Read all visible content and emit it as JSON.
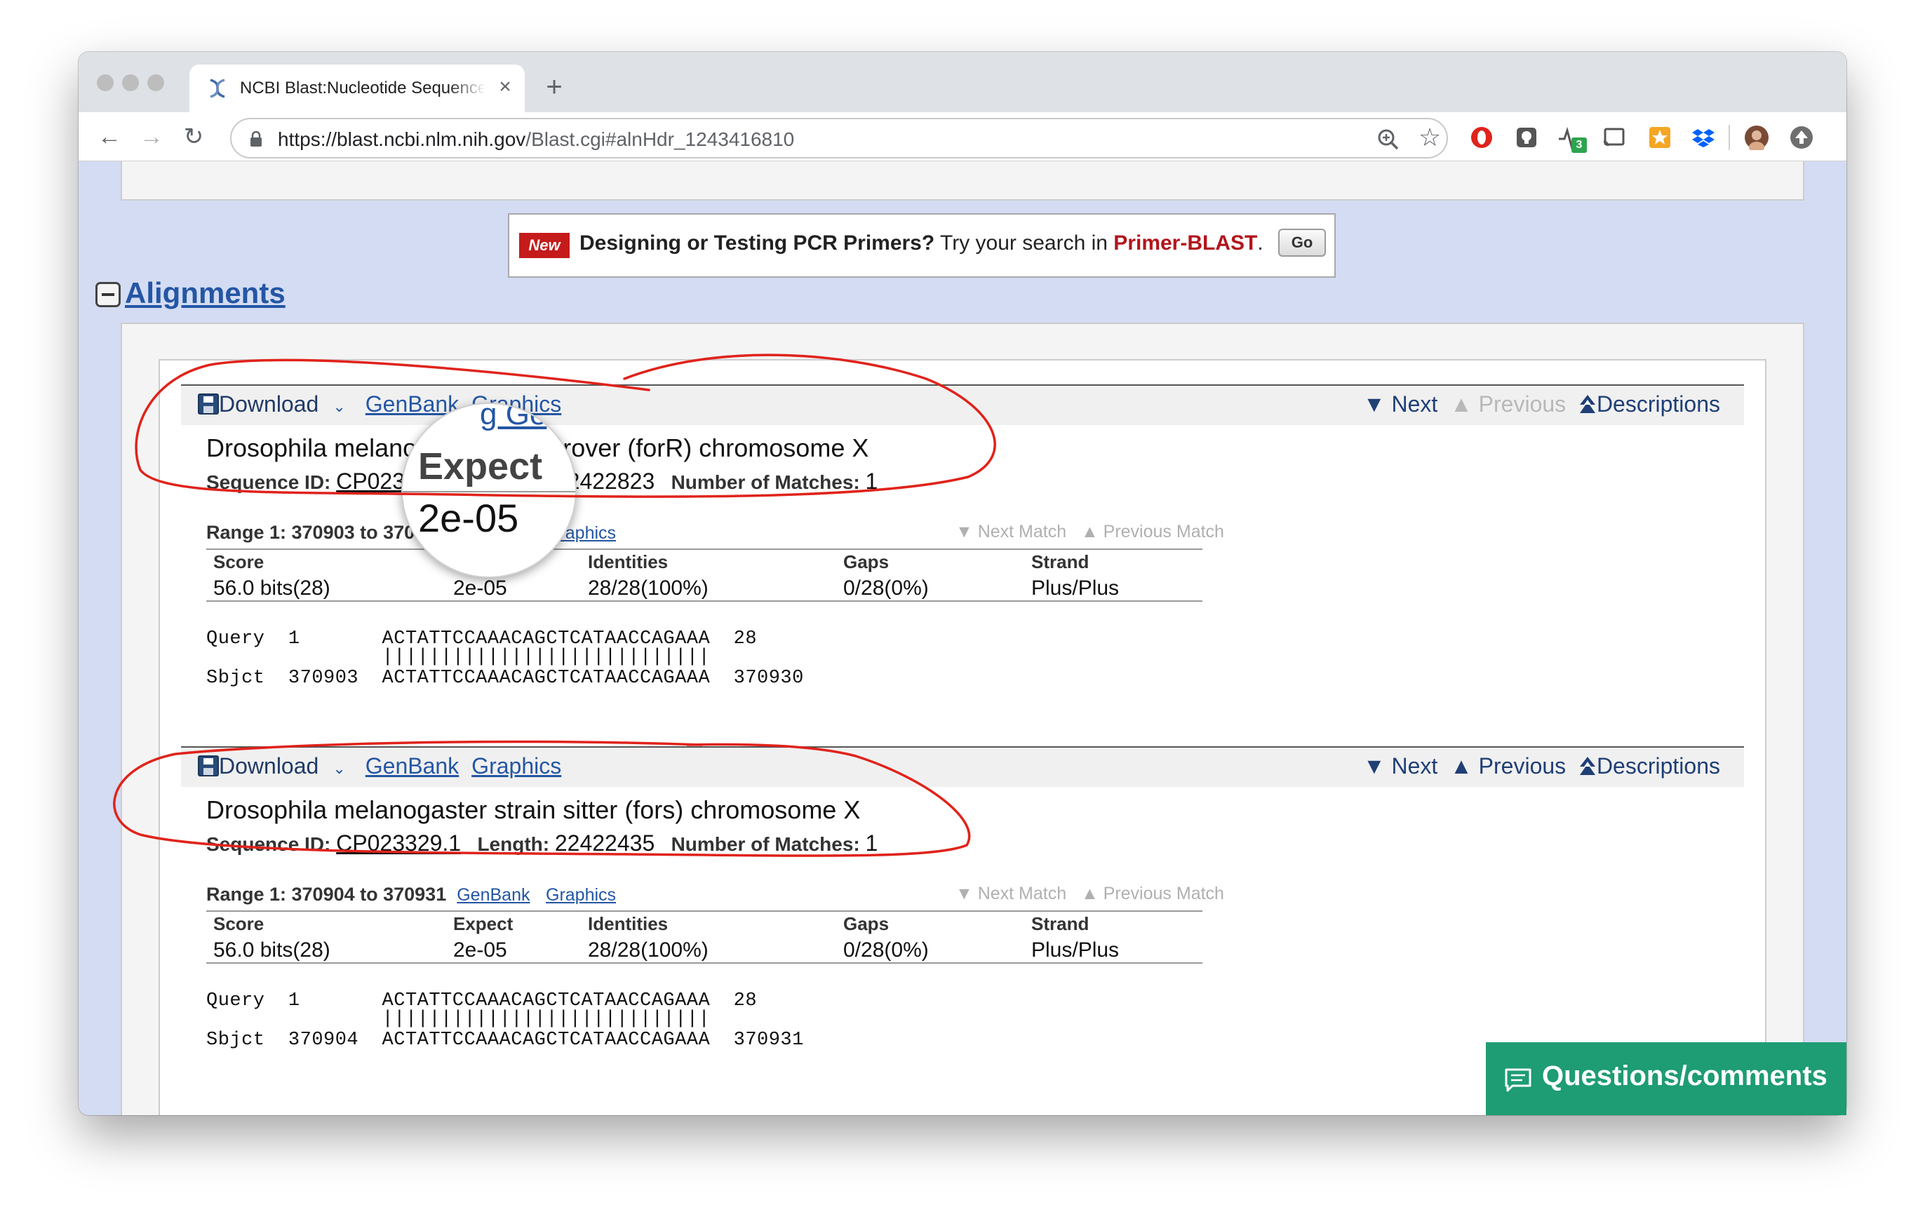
{
  "browser": {
    "tab_title": "NCBI Blast:Nucleotide Sequence",
    "tab_close": "×",
    "new_tab": "+",
    "url_host": "https://blast.ncbi.nlm.nih.gov",
    "url_path": "/Blast.cgi#alnHdr_1243416810",
    "back": "←",
    "forward": "→",
    "reload": "↻",
    "star": "☆",
    "extension_badge": "3"
  },
  "promo": {
    "badge": "New",
    "bold_text": "Designing or Testing PCR Primers?",
    "text": " Try your search in ",
    "link": "Primer-BLAST",
    "tail": ".",
    "go": "Go"
  },
  "section_title": "Alignments",
  "hits": [
    {
      "toolbar": {
        "download": "Download",
        "genbank": "GenBank",
        "graphics": "Graphics",
        "next": "▼ Next",
        "previous": "▲ Previous",
        "previous_disabled": true,
        "descriptions": "Descriptions"
      },
      "title": "Drosophila melanogaster strain rover (forR) chromosome X",
      "sequence_id_label": "Sequence ID:",
      "sequence_id": "CP023335.1",
      "length_label": "Length:",
      "length": "22422823",
      "matches_label": "Number of Matches:",
      "matches": "1",
      "range": "Range 1: 370903 to 370930",
      "range_genbank": "GenBank",
      "range_graphics": "Graphics",
      "next_match": "▼ Next Match",
      "previous_match": "▲ Previous Match",
      "stats": {
        "score_h": "Score",
        "score": "56.0 bits(28)",
        "expect_h": "Expect",
        "expect": "2e-05",
        "identities_h": "Identities",
        "identities": "28/28(100%)",
        "gaps_h": "Gaps",
        "gaps": "0/28(0%)",
        "strand_h": "Strand",
        "strand": "Plus/Plus"
      },
      "query": "Query  1       ACTATTCCAAACAGCTCATAACCAGAAA  28",
      "bars": "               ||||||||||||||||||||||||||||",
      "sbjct": "Sbjct  370903  ACTATTCCAAACAGCTCATAACCAGAAA  370930"
    },
    {
      "toolbar": {
        "download": "Download",
        "genbank": "GenBank",
        "graphics": "Graphics",
        "next": "▼ Next",
        "previous": "▲ Previous",
        "previous_disabled": false,
        "descriptions": "Descriptions"
      },
      "title": "Drosophila melanogaster strain sitter (fors) chromosome X",
      "sequence_id_label": "Sequence ID:",
      "sequence_id": "CP023329.1",
      "length_label": "Length:",
      "length": "22422435",
      "matches_label": "Number of Matches:",
      "matches": "1",
      "range": "Range 1: 370904 to 370931",
      "range_genbank": "GenBank",
      "range_graphics": "Graphics",
      "next_match": "▼ Next Match",
      "previous_match": "▲ Previous Match",
      "stats": {
        "score_h": "Score",
        "score": "56.0 bits(28)",
        "expect_h": "Expect",
        "expect": "2e-05",
        "identities_h": "Identities",
        "identities": "28/28(100%)",
        "gaps_h": "Gaps",
        "gaps": "0/28(0%)",
        "strand_h": "Strand",
        "strand": "Plus/Plus"
      },
      "query": "Query  1       ACTATTCCAAACAGCTCATAACCAGAAA  28",
      "bars": "               ||||||||||||||||||||||||||||",
      "sbjct": "Sbjct  370904  ACTATTCCAAACAGCTCATAACCAGAAA  370931"
    }
  ],
  "magnifier": {
    "label": "Expect",
    "value": "2e-05",
    "fragment": "g Ge"
  },
  "feedback": "Questions/comments",
  "colors": {
    "link": "#2456a4",
    "annotation": "#e0231b",
    "feedback": "#1e9c73",
    "page_bg": "#d3dcf3"
  }
}
